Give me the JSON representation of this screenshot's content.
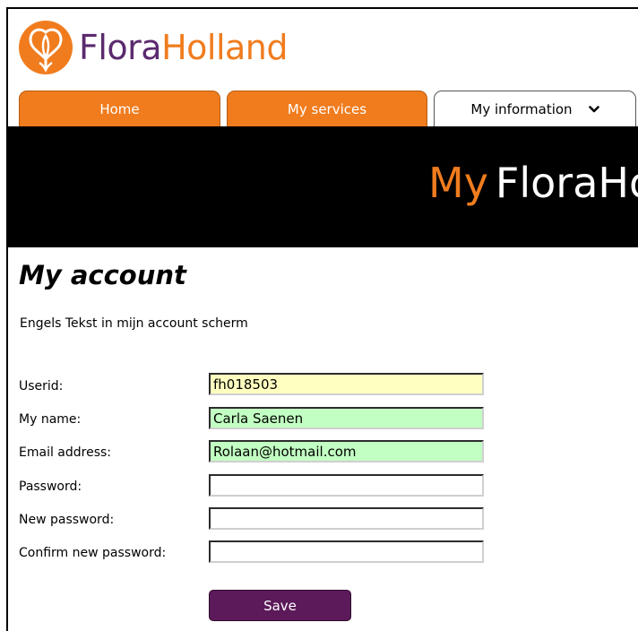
{
  "brand": {
    "name_part1": "Flora",
    "name_part2": "Holland",
    "logo_icon": "tulip-logo-icon",
    "colors": {
      "orange": "#f07c1e",
      "purple": "#5b2a6e",
      "button": "#5c1a5a"
    }
  },
  "nav": {
    "tabs": [
      {
        "label": "Home",
        "active": false
      },
      {
        "label": "My services",
        "active": false
      },
      {
        "label": "My information",
        "active": true,
        "icon": "chevron-down-icon"
      }
    ]
  },
  "banner": {
    "my": "My",
    "brand": "FloraHo"
  },
  "page": {
    "title": "My account",
    "intro": "Engels Tekst in mijn account scherm"
  },
  "form": {
    "fields": [
      {
        "label": "Userid:",
        "value": "fh018503",
        "bg": "#ffffc0"
      },
      {
        "label": "My name:",
        "value": "Carla Saenen",
        "bg": "#c2ffc2"
      },
      {
        "label": "Email address:",
        "value": "Rolaan@hotmail.com",
        "bg": "#c2ffc2"
      },
      {
        "label": "Password:",
        "value": ""
      },
      {
        "label": "New password:",
        "value": ""
      },
      {
        "label": "Confirm new password:",
        "value": ""
      }
    ],
    "save_label": "Save"
  }
}
